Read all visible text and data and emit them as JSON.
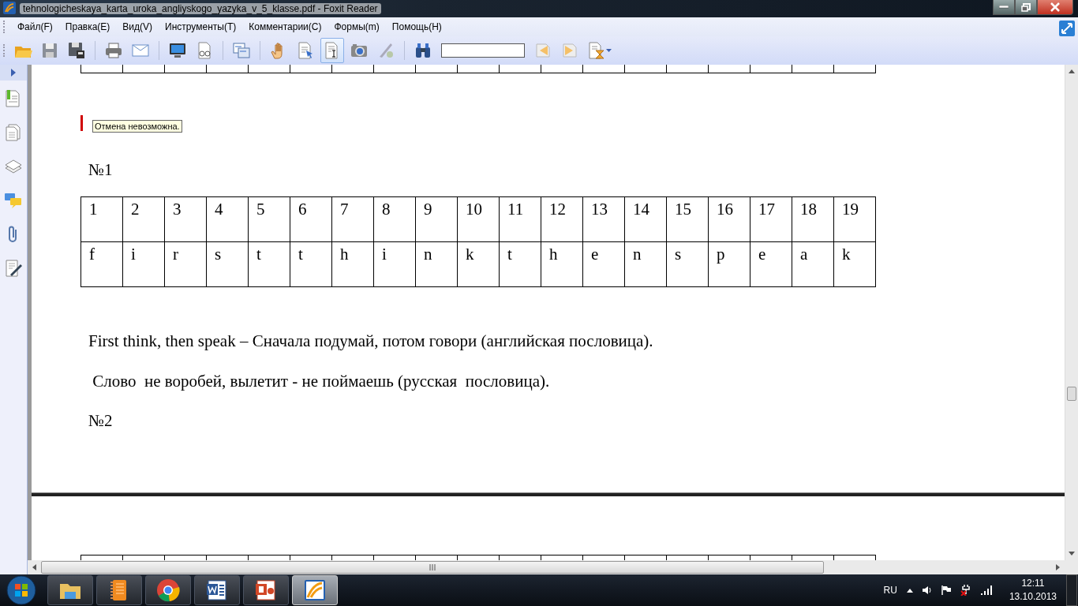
{
  "window": {
    "title": "tehnologicheskaya_karta_uroka_angliyskogo_yazyka_v_5_klasse.pdf - Foxit Reader"
  },
  "menu": [
    "Файл(F)",
    "Правка(E)",
    "Вид(V)",
    "Инструменты(T)",
    "Комментарии(C)",
    "Формы(m)",
    "Помощь(H)"
  ],
  "toolbar": {
    "tools": [
      {
        "kind": "open",
        "selected": false
      },
      {
        "kind": "save",
        "selected": false
      },
      {
        "kind": "saveas",
        "selected": false
      },
      {
        "kind": "sep"
      },
      {
        "kind": "print",
        "selected": false
      },
      {
        "kind": "email",
        "selected": false
      },
      {
        "kind": "sep"
      },
      {
        "kind": "monitor",
        "selected": false
      },
      {
        "kind": "glasses",
        "selected": false
      },
      {
        "kind": "sep"
      },
      {
        "kind": "pages",
        "selected": false
      },
      {
        "kind": "sep"
      },
      {
        "kind": "hand",
        "selected": false
      },
      {
        "kind": "select",
        "selected": false
      },
      {
        "kind": "text",
        "selected": true
      },
      {
        "kind": "camera",
        "selected": false
      },
      {
        "kind": "pen",
        "selected": false
      },
      {
        "kind": "sep"
      },
      {
        "kind": "binoculars",
        "selected": false
      },
      {
        "kind": "search"
      },
      {
        "kind": "prev",
        "selected": false
      },
      {
        "kind": "next",
        "selected": false
      },
      {
        "kind": "hourglass",
        "selected": false
      }
    ]
  },
  "sidebar": {
    "items": [
      {
        "kind": "bookmark"
      },
      {
        "kind": "pages"
      },
      {
        "kind": "layers"
      },
      {
        "kind": "comments"
      },
      {
        "kind": "attachment"
      },
      {
        "kind": "signature"
      }
    ]
  },
  "document": {
    "tooltip": "Отмена невозможна.",
    "section_1": "№1",
    "table": {
      "rows": [
        [
          "1",
          "2",
          "3",
          "4",
          "5",
          "6",
          "7",
          "8",
          "9",
          "10",
          "11",
          "12",
          "13",
          "14",
          "15",
          "16",
          "17",
          "18",
          "19"
        ],
        [
          "f",
          "i",
          "r",
          "s",
          "t",
          "t",
          "h",
          "i",
          "n",
          "k",
          "t",
          "h",
          "e",
          "n",
          "s",
          "p",
          "e",
          "a",
          "k"
        ]
      ]
    },
    "paragraphs": [
      "First think, then speak – Сначала подумай, потом говори (английская пословица).",
      " Слово  не воробей, вылетит - не поймаешь (русская  пословица)."
    ],
    "section_2": "№2"
  },
  "taskbar": {
    "apps": [
      {
        "kind": "folder",
        "selected": false
      },
      {
        "kind": "notebook",
        "selected": false
      },
      {
        "kind": "browser",
        "selected": false
      },
      {
        "kind": "word",
        "selected": false
      },
      {
        "kind": "slides",
        "selected": false
      },
      {
        "kind": "reader",
        "selected": true
      }
    ],
    "language": "RU",
    "time": "12:11",
    "date": "13.10.2013"
  }
}
